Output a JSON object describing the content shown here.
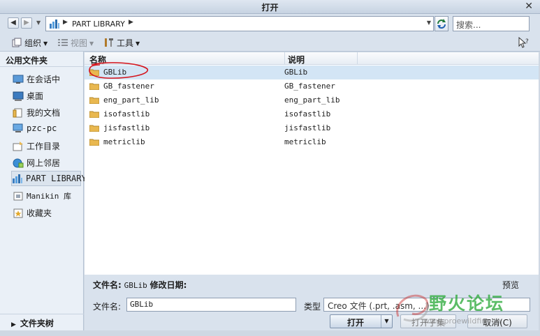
{
  "window": {
    "title": "打开",
    "close_glyph": "✕"
  },
  "address": {
    "path": "PART LIBRARY",
    "search_placeholder": "搜索..."
  },
  "toolbar": {
    "organize": "组织",
    "views": "视图",
    "tools": "工具",
    "help_glyph": "⁇"
  },
  "sidebar": {
    "header": "公用文件夹",
    "items": [
      {
        "label": "在会话中",
        "icon": "session-icon"
      },
      {
        "label": "桌面",
        "icon": "desktop-icon"
      },
      {
        "label": "我的文档",
        "icon": "documents-icon"
      },
      {
        "label": "pzc-pc",
        "icon": "computer-icon"
      },
      {
        "label": "工作目录",
        "icon": "working-dir-icon"
      },
      {
        "label": "网上邻居",
        "icon": "network-icon"
      },
      {
        "label": "PART LIBRARY",
        "icon": "library-icon",
        "selected": true
      },
      {
        "label": "Manikin 库",
        "icon": "manikin-library-icon"
      },
      {
        "label": "收藏夹",
        "icon": "favorites-icon"
      }
    ],
    "folder_tree": "文件夹树"
  },
  "list": {
    "columns": [
      "名称",
      "说明"
    ],
    "rows": [
      {
        "name": "GBLib",
        "desc": "GBLib",
        "selected": true
      },
      {
        "name": "GB_fastener",
        "desc": "GB_fastener"
      },
      {
        "name": "eng_part_lib",
        "desc": "eng_part_lib"
      },
      {
        "name": "isofastlib",
        "desc": "isofastlib"
      },
      {
        "name": "jisfastlib",
        "desc": "jisfastlib"
      },
      {
        "name": "metriclib",
        "desc": "metriclib"
      }
    ]
  },
  "details": {
    "filename_label": "文件名:",
    "filename_value": "GBLib",
    "modified_label": "修改日期:",
    "preview": "预览"
  },
  "form": {
    "filename_label": "文件名:",
    "filename_value": "GBLib",
    "type_label": "类型",
    "type_value": "Creo 文件 (.prt, .asm, ...)",
    "open": "打开",
    "open_subset": "打开子集",
    "cancel": "取消(C)"
  },
  "watermark": {
    "text": "野火论坛",
    "url": "www.proewildfire.cn"
  },
  "colors": {
    "selection": "#d3e5f5",
    "annotation_red": "#d4141c",
    "folder": "#e9b850"
  }
}
